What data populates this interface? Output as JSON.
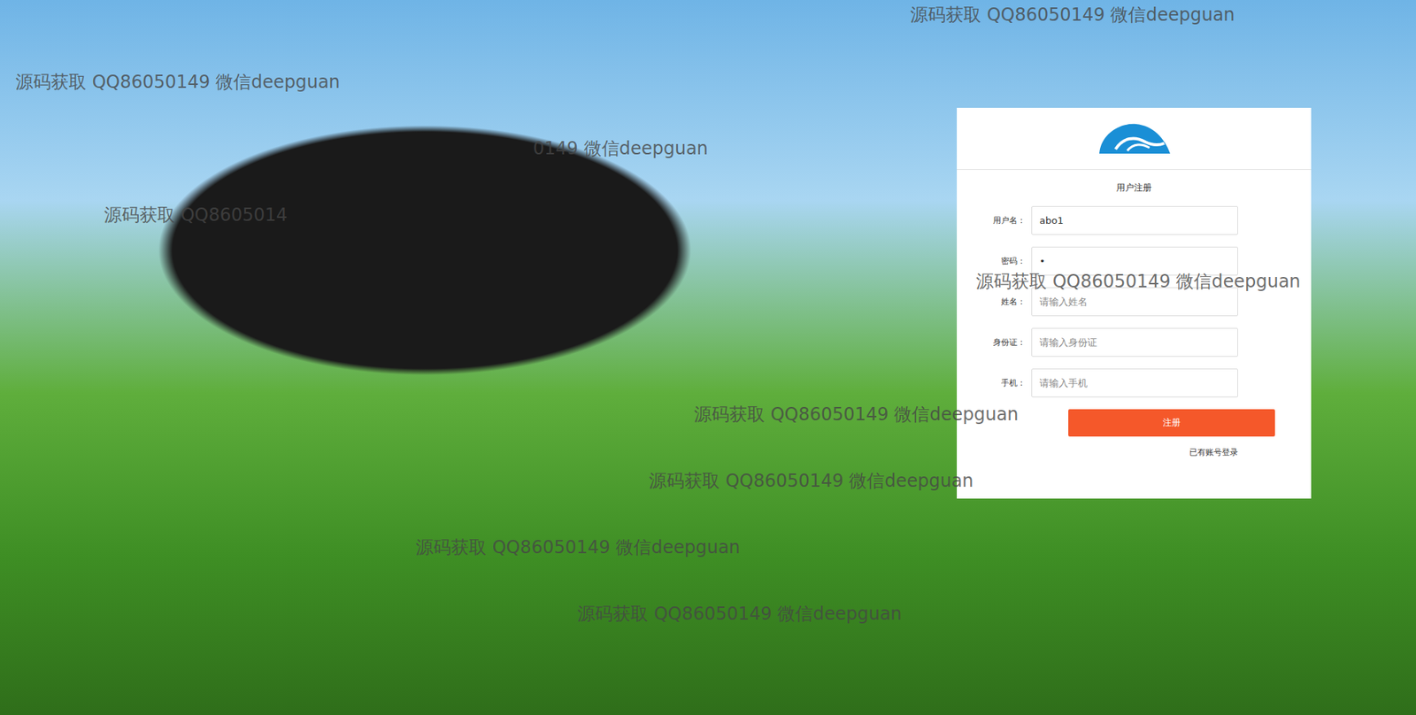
{
  "form": {
    "title": "用户注册",
    "fields": [
      {
        "label": "用户名：",
        "value": "abo1",
        "placeholder": ""
      },
      {
        "label": "密码：",
        "value": "•",
        "placeholder": ""
      },
      {
        "label": "姓名：",
        "value": "",
        "placeholder": "请输入姓名"
      },
      {
        "label": "身份证：",
        "value": "",
        "placeholder": "请输入身份证"
      },
      {
        "label": "手机：",
        "value": "",
        "placeholder": "请输入手机"
      }
    ],
    "submit": "注册",
    "login_link": "已有账号登录"
  },
  "watermarks": [
    "源码获取 QQ86050149 微信deepguan",
    "源码获取 QQ86050149 微信deepguan",
    "0149 微信deepguan",
    "源码获取 QQ8605014",
    "源码获取 QQ86050149 微信deepguan",
    "源码获取 QQ86050149 微信deepguan",
    "源码获取 QQ86050149 微信deepguan",
    "源码获取 QQ86050149 微信deepguan",
    "源码获取 QQ86050149 微信deepguan"
  ]
}
